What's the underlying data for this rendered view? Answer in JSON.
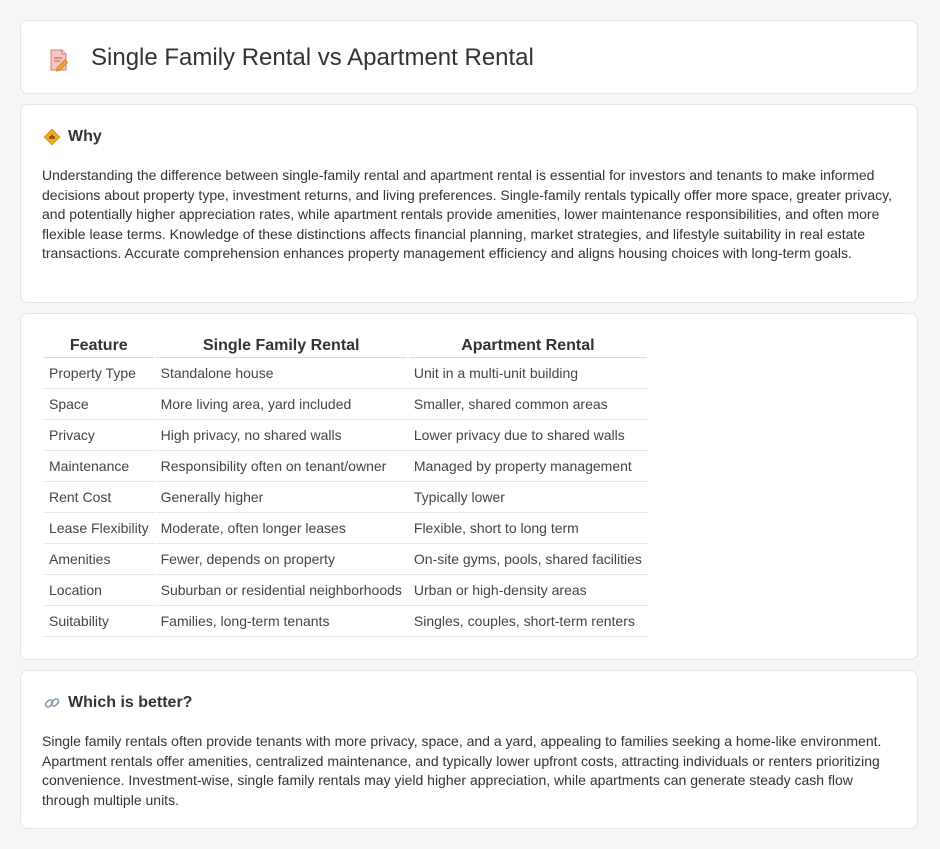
{
  "header": {
    "title": "Single Family Rental vs Apartment Rental",
    "icon": "document-edit-icon"
  },
  "why": {
    "heading": "Why",
    "icon": "diamond-signal-icon",
    "text": "Understanding the difference between single-family rental and apartment rental is essential for investors and tenants to make informed decisions about property type, investment returns, and living preferences. Single-family rentals typically offer more space, greater privacy, and potentially higher appreciation rates, while apartment rentals provide amenities, lower maintenance responsibilities, and often more flexible lease terms. Knowledge of these distinctions affects financial planning, market strategies, and lifestyle suitability in real estate transactions. Accurate comprehension enhances property management efficiency and aligns housing choices with long-term goals."
  },
  "table": {
    "headers": [
      "Feature",
      "Single Family Rental",
      "Apartment Rental"
    ],
    "rows": [
      [
        "Property Type",
        "Standalone house",
        "Unit in a multi-unit building"
      ],
      [
        "Space",
        "More living area, yard included",
        "Smaller, shared common areas"
      ],
      [
        "Privacy",
        "High privacy, no shared walls",
        "Lower privacy due to shared walls"
      ],
      [
        "Maintenance",
        "Responsibility often on tenant/owner",
        "Managed by property management"
      ],
      [
        "Rent Cost",
        "Generally higher",
        "Typically lower"
      ],
      [
        "Lease Flexibility",
        "Moderate, often longer leases",
        "Flexible, short to long term"
      ],
      [
        "Amenities",
        "Fewer, depends on property",
        "On-site gyms, pools, shared facilities"
      ],
      [
        "Location",
        "Suburban or residential neighborhoods",
        "Urban or high-density areas"
      ],
      [
        "Suitability",
        "Families, long-term tenants",
        "Singles, couples, short-term renters"
      ]
    ]
  },
  "better": {
    "heading": "Which is better?",
    "icon": "link-icon",
    "text": "Single family rentals often provide tenants with more privacy, space, and a yard, appealing to families seeking a home-like environment. Apartment rentals offer amenities, centralized maintenance, and typically lower upfront costs, attracting individuals or renters prioritizing convenience. Investment-wise, single family rentals may yield higher appreciation, while apartments can generate steady cash flow through multiple units."
  }
}
